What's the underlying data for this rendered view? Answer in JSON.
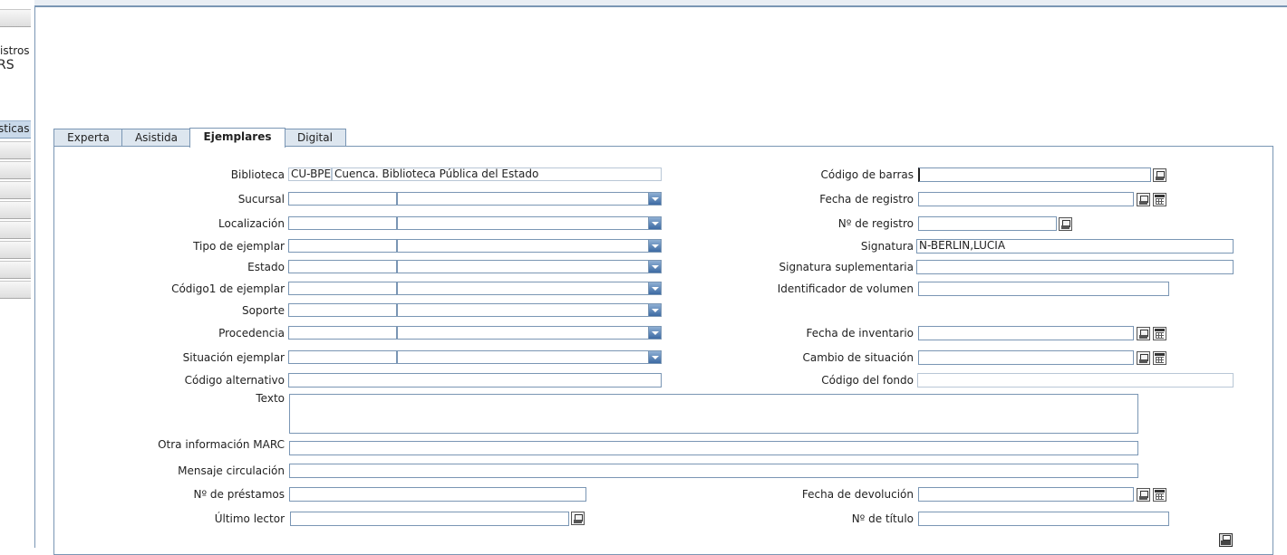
{
  "sidebar": {
    "text_lines": [
      "istros",
      "rs"
    ],
    "active_label": "sticas"
  },
  "tabs": [
    "Experta",
    "Asistida",
    "Ejemplares",
    "Digital"
  ],
  "active_tab": "Ejemplares",
  "form_left": {
    "biblioteca_label": "Biblioteca",
    "biblioteca_code": "CU-BPE",
    "biblioteca_name": "Cuenca. Biblioteca Pública del Estado",
    "sucursal_label": "Sucursal",
    "localizacion_label": "Localización",
    "tipo_ejemplar_label": "Tipo de ejemplar",
    "estado_label": "Estado",
    "codigo1_label": "Código1 de ejemplar",
    "soporte_label": "Soporte",
    "procedencia_label": "Procedencia",
    "situacion_label": "Situación ejemplar",
    "codigo_alternativo_label": "Código alternativo",
    "texto_label": "Texto",
    "otra_info_label": "Otra información MARC",
    "mensaje_label": "Mensaje circulación",
    "num_prestamos_label": "Nº de préstamos",
    "ultimo_lector_label": "Último lector"
  },
  "form_right": {
    "codigo_barras_label": "Código de barras",
    "fecha_registro_label": "Fecha de registro",
    "num_registro_label": "Nº de registro",
    "signatura_label": "Signatura",
    "signatura_value": "N-BERLIN,LUCIA",
    "signatura_sup_label": "Signatura suplementaria",
    "identificador_label": "Identificador de volumen",
    "fecha_inventario_label": "Fecha de inventario",
    "cambio_situacion_label": "Cambio de situación",
    "codigo_fondo_label": "Código del fondo",
    "fecha_devolucion_label": "Fecha de devolución",
    "num_titulo_label": "Nº de título"
  },
  "icons": {
    "lookup": "lookup-icon",
    "calendar": "calendar-icon",
    "print": "print-icon"
  },
  "colors": {
    "border": "#7a96b4",
    "tab_bg": "#dde6ef",
    "select_button": "#3c6aa3"
  }
}
